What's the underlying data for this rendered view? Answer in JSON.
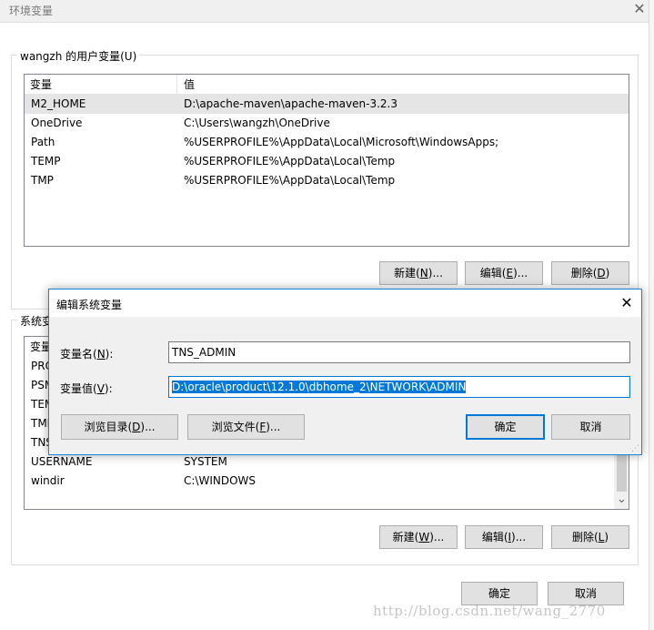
{
  "main_window": {
    "title": "环境变量",
    "close_glyph": "✕"
  },
  "user_vars": {
    "group_label": "wangzh 的用户变量(U)",
    "col_variable": "变量",
    "col_value": "值",
    "rows": [
      {
        "name": "M2_HOME",
        "value": "D:\\apache-maven\\apache-maven-3.2.3"
      },
      {
        "name": "OneDrive",
        "value": "C:\\Users\\wangzh\\OneDrive"
      },
      {
        "name": "Path",
        "value": "%USERPROFILE%\\AppData\\Local\\Microsoft\\WindowsApps;"
      },
      {
        "name": "TEMP",
        "value": "%USERPROFILE%\\AppData\\Local\\Temp"
      },
      {
        "name": "TMP",
        "value": "%USERPROFILE%\\AppData\\Local\\Temp"
      }
    ],
    "btn_new": "新建(",
    "btn_new_key": "N",
    "btn_new_tail": ")...",
    "btn_edit": "编辑(",
    "btn_edit_key": "E",
    "btn_edit_tail": ")...",
    "btn_delete": "删除(",
    "btn_delete_key": "D",
    "btn_delete_tail": ")"
  },
  "system_vars": {
    "group_label_partial": "系统变",
    "col_variable_partial": "变量",
    "partial_rows": [
      "PRO",
      "PSM",
      "TEM",
      "TMF",
      "TNS"
    ],
    "rows": [
      {
        "name": "USERNAME",
        "value": "SYSTEM"
      },
      {
        "name": "windir",
        "value": "C:\\WINDOWS"
      }
    ],
    "btn_new": "新建(",
    "btn_new_key": "W",
    "btn_new_tail": ")...",
    "btn_edit": "编辑(",
    "btn_edit_key": "I",
    "btn_edit_tail": ")...",
    "btn_delete": "删除(",
    "btn_delete_key": "L",
    "btn_delete_tail": ")",
    "scroll_down_glyph": "⌄"
  },
  "footer": {
    "ok": "确定",
    "cancel": "取消"
  },
  "dialog": {
    "title": "编辑系统变量",
    "close_glyph": "✕",
    "name_label_a": "变量名(",
    "name_label_key": "N",
    "name_label_b": "):",
    "name_value": "TNS_ADMIN",
    "value_label_a": "变量值(",
    "value_label_key": "V",
    "value_label_b": "):",
    "value_value": "D:\\oracle\\product\\12.1.0\\dbhome_2\\NETWORK\\ADMIN",
    "btn_browse_dir": "浏览目录(",
    "btn_browse_dir_key": "D",
    "btn_browse_dir_tail": ")...",
    "btn_browse_file": "浏览文件(",
    "btn_browse_file_key": "F",
    "btn_browse_file_tail": ")...",
    "ok": "确定",
    "cancel": "取消",
    "grip_glyph": "⋰"
  },
  "watermark": "http://blog.csdn.net/wang_2770",
  "colors": {
    "accent": "#0078d7",
    "selected_row": "#e5e5e5",
    "button_bg": "#e1e1e1"
  }
}
